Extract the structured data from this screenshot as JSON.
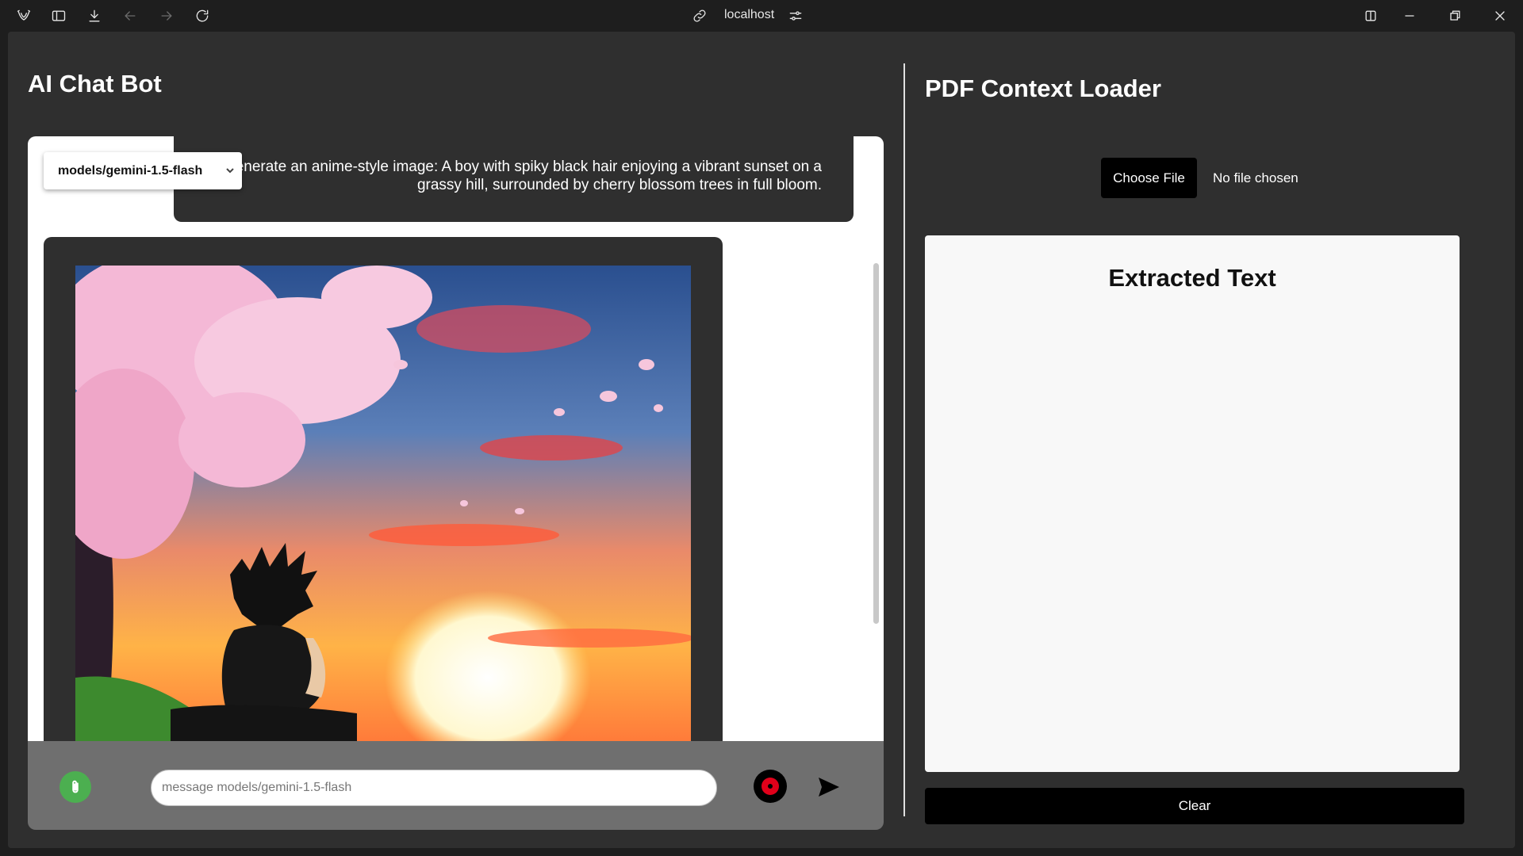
{
  "browser": {
    "url": "localhost",
    "icons": [
      "app-logo-icon",
      "sidebar-icon",
      "download-icon",
      "back-icon",
      "forward-icon",
      "reload-icon",
      "link-icon",
      "site-settings-icon",
      "split-view-icon",
      "minimize-icon",
      "restore-icon",
      "close-icon"
    ]
  },
  "chat": {
    "title": "AI Chat Bot",
    "model_select": "models/gemini-1.5-flash",
    "user_message": "generate an anime-style image: A boy with spiky black hair enjoying a vibrant sunset on a grassy hill, surrounded by cherry blossom trees in full bloom.",
    "input_placeholder": "message models/gemini-1.5-flash"
  },
  "pdf": {
    "title": "PDF Context Loader",
    "choose_file_label": "Choose File",
    "file_status": "No file chosen",
    "extracted_title": "Extracted Text",
    "clear_label": "Clear"
  },
  "colors": {
    "attach": "#4caf50",
    "record": "#e0001a",
    "panel_bg": "#2f2f2f"
  }
}
